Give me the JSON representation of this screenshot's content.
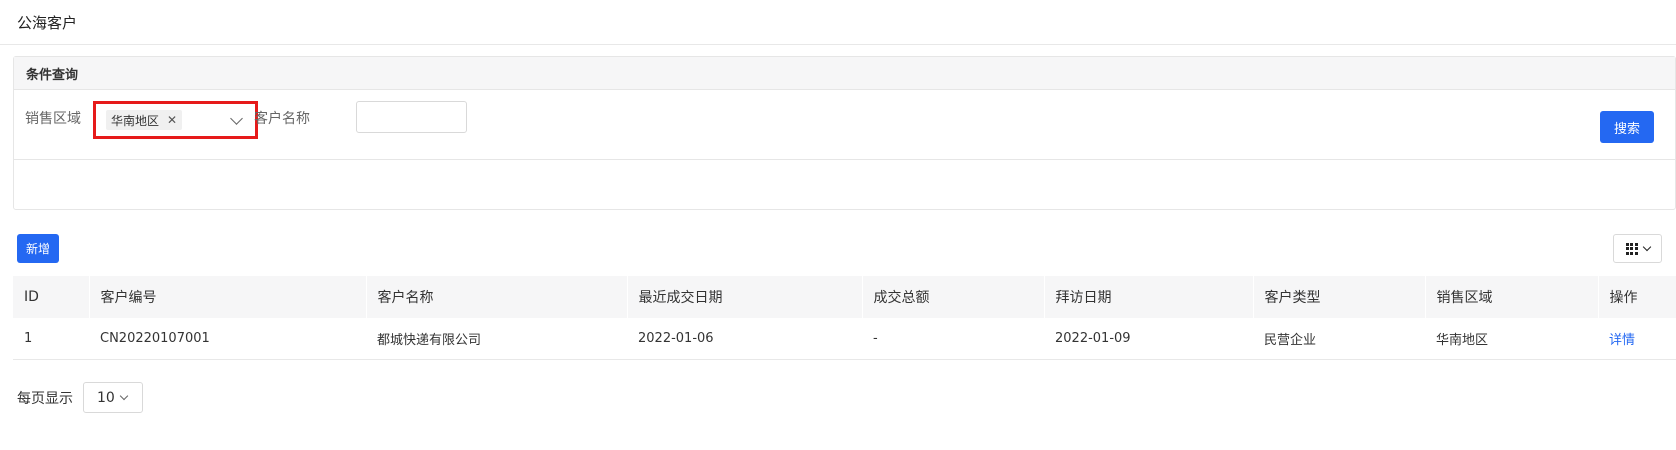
{
  "page": {
    "title": "公海客户"
  },
  "query_panel": {
    "title": "条件查询",
    "sales_region_label": "销售区域",
    "sales_region_selected": "华南地区",
    "customer_name_label": "客户名称",
    "customer_name_value": "",
    "search_label": "搜索"
  },
  "toolbar": {
    "add_label": "新增"
  },
  "table": {
    "columns": [
      "ID",
      "客户编号",
      "客户名称",
      "最近成交日期",
      "成交总额",
      "拜访日期",
      "客户类型",
      "销售区域",
      "操作"
    ],
    "rows": [
      {
        "id": "1",
        "code": "CN20220107001",
        "name": "都城快递有限公司",
        "last_deal_date": "2022-01-06",
        "total": "-",
        "visit_date": "2022-01-09",
        "type": "民营企业",
        "region": "华南地区",
        "action": "详情"
      }
    ]
  },
  "pagination": {
    "per_page_label": "每页显示",
    "per_page_value": "10"
  },
  "colors": {
    "primary": "#2468f2",
    "highlight_border": "#e61a1a"
  }
}
